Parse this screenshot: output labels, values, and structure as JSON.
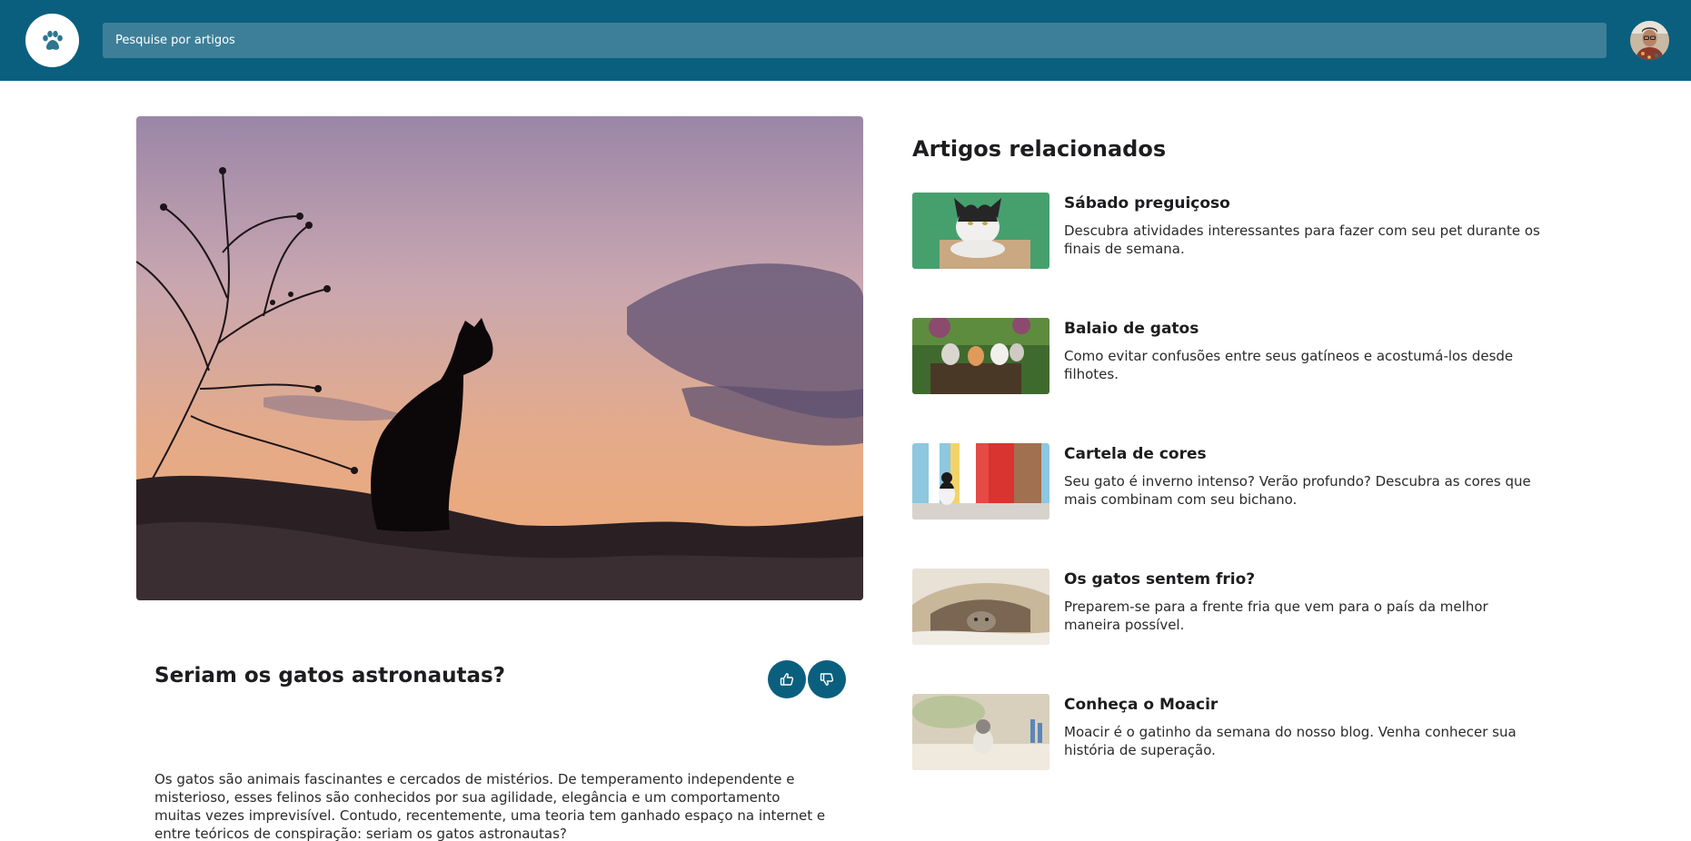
{
  "header": {
    "search_placeholder": "Pesquise por artigos",
    "logo_icon": "paw-icon",
    "colors": {
      "bar": "#0b5f7e",
      "search": "#3d7f99"
    }
  },
  "article": {
    "title": "Seriam os gatos astronautas?",
    "body": "Os gatos são animais fascinantes e cercados de mistérios. De temperamento independente e misterioso, esses felinos são conhecidos por sua agilidade, elegância e um comportamento muitas vezes imprevisível. Contudo, recentemente, uma teoria tem ganhado espaço na internet e entre teóricos de conspiração: seriam os gatos astronautas?",
    "like_icon": "thumbs-up-icon",
    "dislike_icon": "thumbs-down-icon"
  },
  "related": {
    "heading": "Artigos relacionados",
    "items": [
      {
        "title": "Sábado preguiçoso",
        "description": "Descubra atividades interessantes para fazer com seu pet durante os finais de semana."
      },
      {
        "title": "Balaio de gatos",
        "description": "Como evitar confusões entre seus gatíneos e acostumá-los desde filhotes."
      },
      {
        "title": "Cartela de cores",
        "description": "Seu gato é inverno intenso? Verão profundo? Descubra as cores que mais combinam com seu bichano."
      },
      {
        "title": "Os gatos sentem frio?",
        "description": "Preparem-se para a frente fria que vem para o país da melhor maneira possível."
      },
      {
        "title": "Conheça o Moacir",
        "description": "Moacir é o gatinho da semana do nosso blog. Venha conhecer sua história de superação."
      }
    ]
  }
}
